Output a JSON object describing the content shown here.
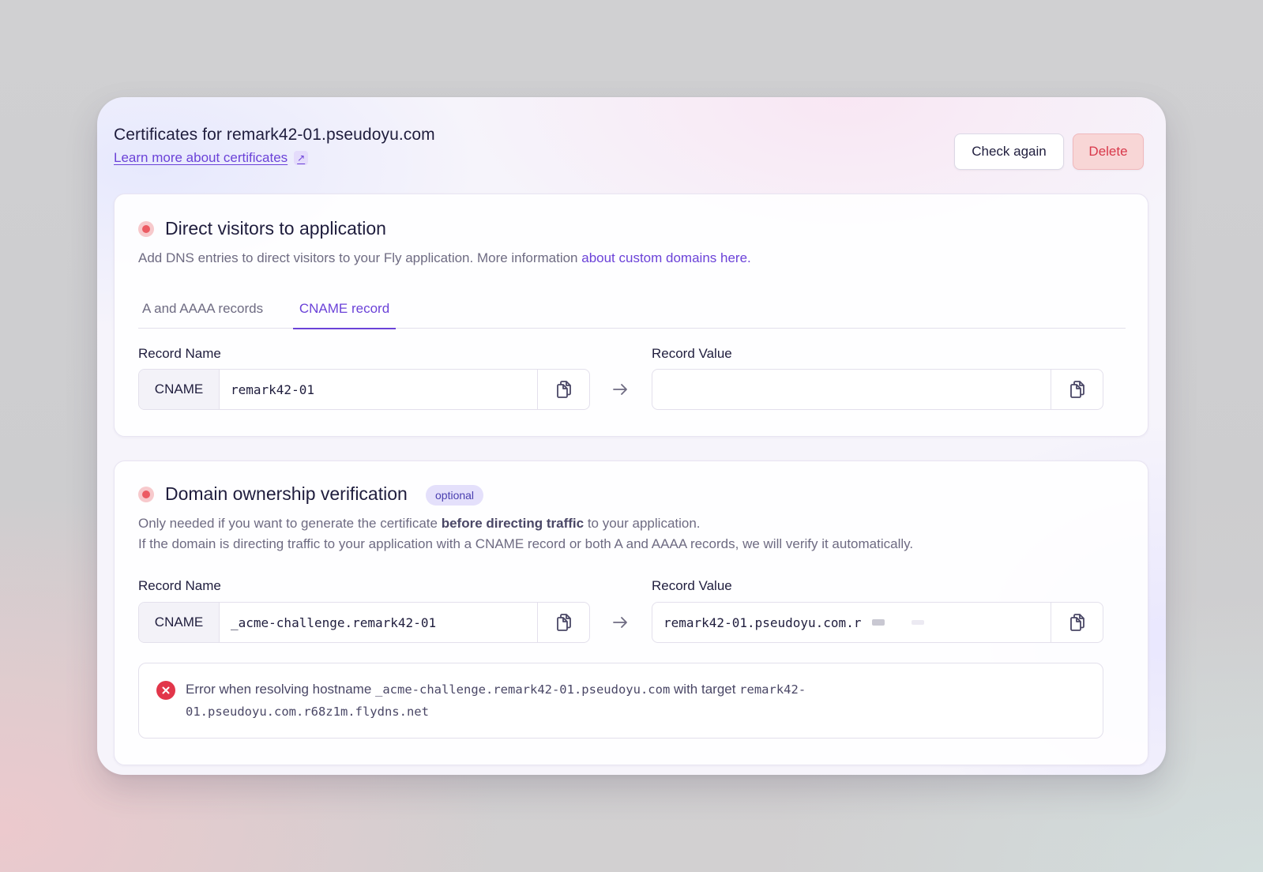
{
  "header": {
    "title": "Certificates for remark42-01.pseudoyu.com",
    "learn_more": "Learn more about certificates",
    "check_again": "Check again",
    "delete": "Delete"
  },
  "direct": {
    "title": "Direct visitors to application",
    "desc_prefix": "Add DNS entries to direct visitors to your Fly application. More information ",
    "desc_link": "about custom domains here.",
    "tabs": [
      "A and AAAA records",
      "CNAME record"
    ],
    "active_tab": "CNAME record",
    "record_name_label": "Record Name",
    "record_value_label": "Record Value",
    "record_type": "CNAME",
    "record_name": "remark42-01",
    "record_value": ""
  },
  "ownership": {
    "title": "Domain ownership verification",
    "badge": "optional",
    "line1_a": "Only needed if you want to generate the certificate ",
    "line1_b": "before directing traffic",
    "line1_c": " to your application.",
    "line2": "If the domain is directing traffic to your application with a CNAME record or both A and AAAA records, we will verify it automatically.",
    "record_name_label": "Record Name",
    "record_value_label": "Record Value",
    "record_type": "CNAME",
    "record_name": "_acme-challenge.remark42-01",
    "record_value": "remark42-01.pseudoyu.com.r",
    "error": {
      "prefix": "Error when resolving hostname ",
      "hostname": "_acme-challenge.remark42-01.pseudoyu.com",
      "middle": " with target ",
      "target_line1": "remark42-",
      "target_line2": "01.pseudoyu.com.r68z1m.flydns.net"
    }
  },
  "colors": {
    "accent": "#6b42d8",
    "danger": "#e2364a",
    "status_dot": "#ec5b63"
  }
}
